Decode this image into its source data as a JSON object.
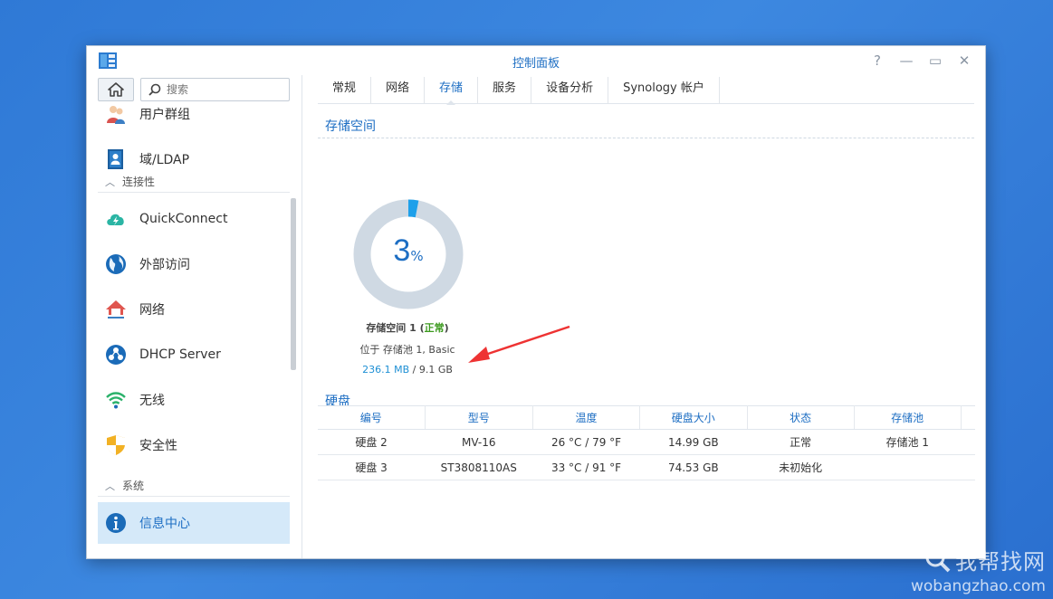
{
  "window": {
    "title": "控制面板",
    "help": "?",
    "minimize": "—",
    "maximize": "▭",
    "close": "✕"
  },
  "sidebar": {
    "search_placeholder": "搜索",
    "items": [
      {
        "label": "用户群组",
        "icon": "user-group-icon"
      },
      {
        "label": "域/LDAP",
        "icon": "ldap-icon"
      },
      {
        "section": "连接性"
      },
      {
        "label": "QuickConnect",
        "icon": "quickconnect-icon"
      },
      {
        "label": "外部访问",
        "icon": "globe-icon"
      },
      {
        "label": "网络",
        "icon": "network-home-icon"
      },
      {
        "label": "DHCP Server",
        "icon": "dhcp-icon"
      },
      {
        "label": "无线",
        "icon": "wifi-icon"
      },
      {
        "label": "安全性",
        "icon": "shield-icon"
      },
      {
        "section": "系统"
      },
      {
        "label": "信息中心",
        "icon": "info-icon"
      }
    ]
  },
  "tabs": [
    "常规",
    "网络",
    "存储",
    "服务",
    "设备分析",
    "Synology 帐户"
  ],
  "active_tab": "存储",
  "storage": {
    "section_title": "存储空间",
    "percent": 3,
    "percent_num": "3",
    "percent_unit": "%",
    "volume_name": "存储空间 1 (",
    "volume_status": "正常",
    "volume_name_end": ")",
    "location": "位于 存储池 1, Basic",
    "used": "236.1 MB",
    "separator": " / ",
    "total": "9.1 GB"
  },
  "disks": {
    "section_title": "硬盘",
    "columns": [
      "编号",
      "型号",
      "温度",
      "硬盘大小",
      "状态",
      "存储池"
    ],
    "rows": [
      [
        "硬盘 2",
        "MV-16",
        "26 °C / 79 °F",
        "14.99 GB",
        "正常",
        "存储池 1"
      ],
      [
        "硬盘 3",
        "ST3808110AS",
        "33 °C / 91 °F",
        "74.53 GB",
        "未初始化",
        ""
      ]
    ]
  },
  "watermark": {
    "cn": "我帮找网",
    "en": "wobangzhao.com"
  },
  "colors": {
    "accent": "#1d6ec3",
    "ok": "#3c9a1e",
    "donut_track": "#cfd9e3",
    "donut_fill": "#1ea0ea"
  }
}
